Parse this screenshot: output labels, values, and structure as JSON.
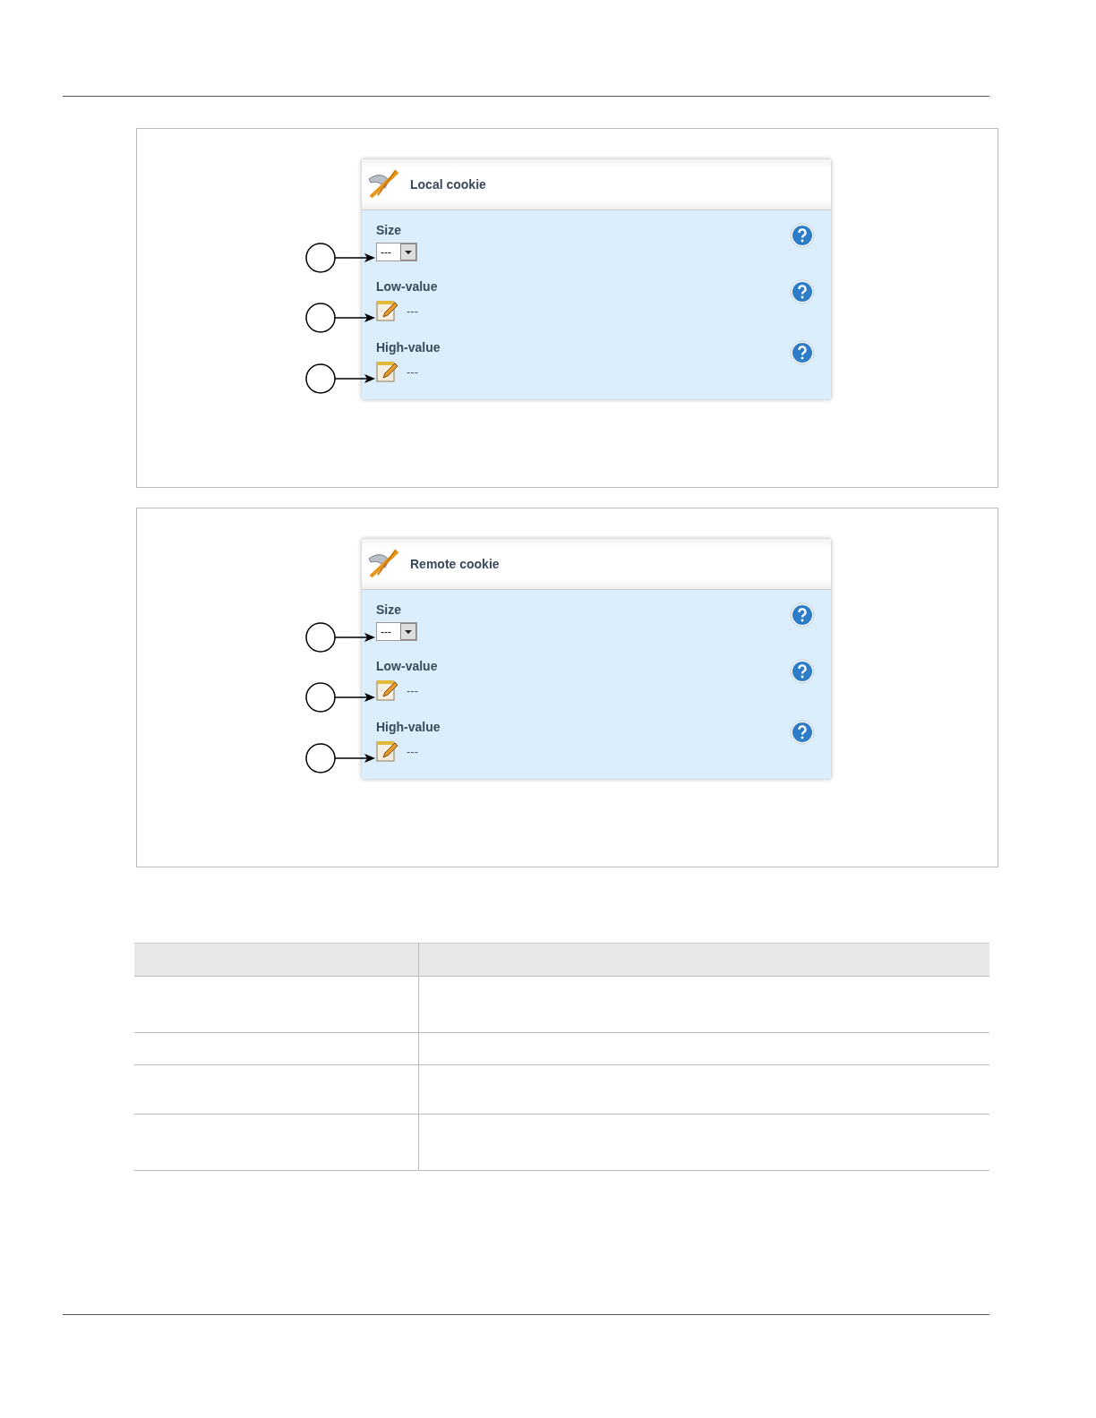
{
  "panels": [
    {
      "title": "Local cookie",
      "fields": [
        {
          "label": "Size",
          "kind": "select",
          "value": "---"
        },
        {
          "label": "Low-value",
          "kind": "text",
          "value": "---"
        },
        {
          "label": "High-value",
          "kind": "text",
          "value": "---"
        }
      ]
    },
    {
      "title": "Remote cookie",
      "fields": [
        {
          "label": "Size",
          "kind": "select",
          "value": "---"
        },
        {
          "label": "Low-value",
          "kind": "text",
          "value": "---"
        },
        {
          "label": "High-value",
          "kind": "text",
          "value": "---"
        }
      ]
    }
  ]
}
